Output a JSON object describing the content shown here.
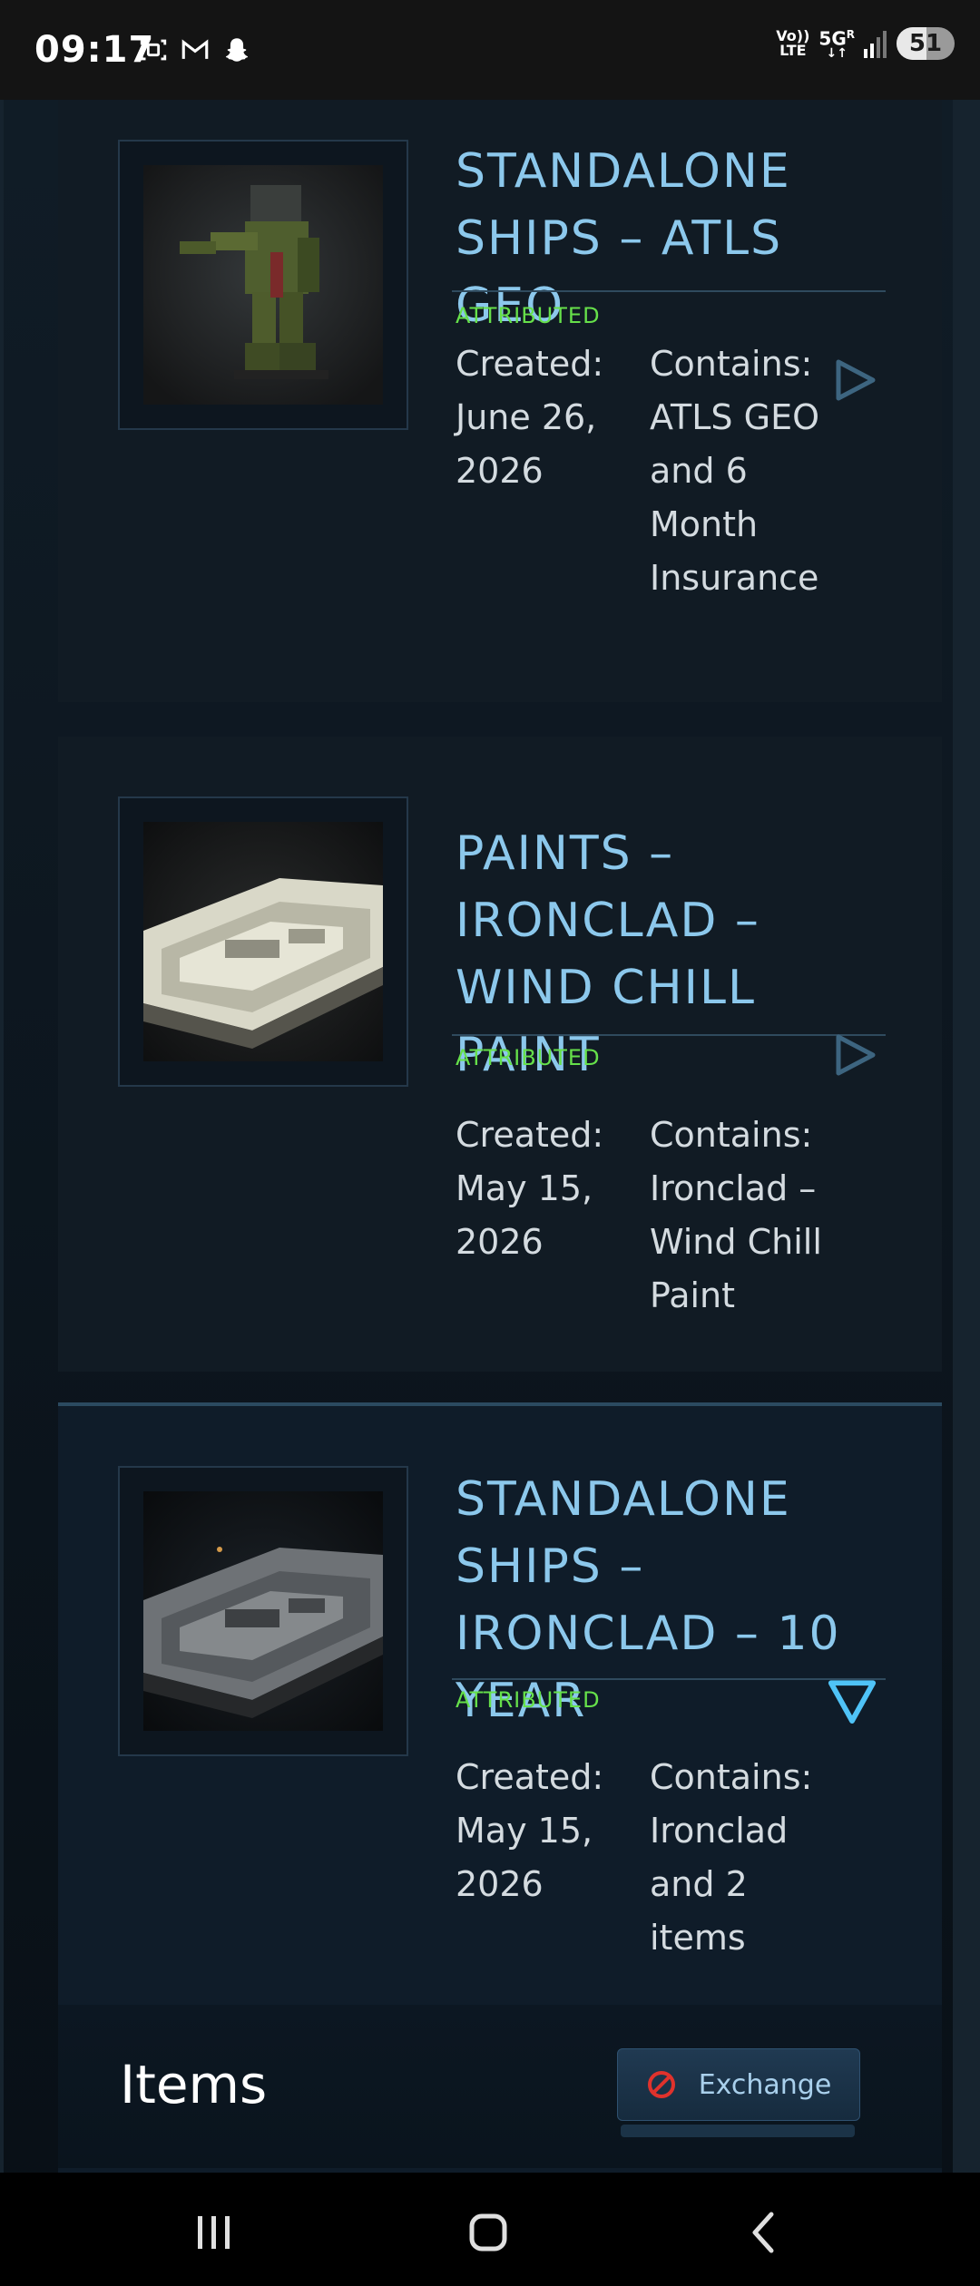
{
  "status_bar": {
    "time": "09:17",
    "left_icons": [
      "screenshot-icon",
      "gmail-icon",
      "snapchat-icon"
    ],
    "volte": [
      "Vo))",
      "LTE"
    ],
    "network": "5G",
    "roaming": "R",
    "battery": "51",
    "battery_level": 0.51
  },
  "cards": [
    {
      "title": "STANDALONE SHIPS – ATLS GEO",
      "status": "ATTRIBUTED",
      "created_label": "Created:",
      "created_date": "June 26, 2026",
      "contains_label": "Contains:",
      "contains_value": "ATLS GEO and 6 Month Insurance",
      "toggle": "expand-arrow-icon"
    },
    {
      "title": "PAINTS – IRONCLAD – WIND CHILL PAINT",
      "status": "ATTRIBUTED",
      "created_label": "Created:",
      "created_date": "May 15, 2026",
      "contains_label": "Contains:",
      "contains_value": "Ironclad – Wind Chill Paint",
      "toggle": "expand-arrow-icon"
    },
    {
      "title": "STANDALONE SHIPS – IRONCLAD – 10 YEAR",
      "status": "ATTRIBUTED",
      "created_label": "Created:",
      "created_date": "May 15, 2026",
      "contains_label": "Contains:",
      "contains_value": "Ironclad and 2 items",
      "toggle": "collapse-arrow-icon"
    }
  ],
  "items_section": {
    "label": "Items",
    "exchange_label": "Exchange",
    "exchange_icon": "blocked-icon"
  },
  "nav": [
    "recents-icon",
    "home-icon",
    "back-icon"
  ],
  "colors": {
    "title": "#8cc8ec",
    "status": "#66e04a",
    "accent": "#4fc3f7"
  }
}
